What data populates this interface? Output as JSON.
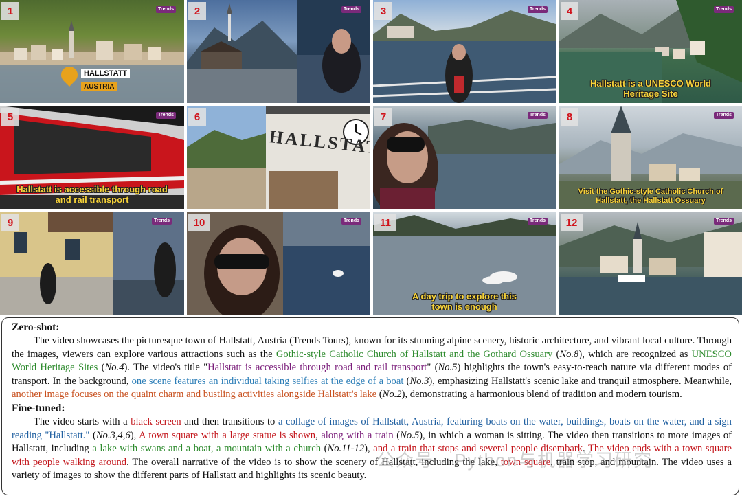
{
  "tiles": [
    {
      "num": "1",
      "wm": "Trends",
      "labels": [
        "HALLSTATT",
        "AUSTRIA"
      ]
    },
    {
      "num": "2",
      "wm": "Trends"
    },
    {
      "num": "3",
      "wm": "Trends"
    },
    {
      "num": "4",
      "wm": "Trends",
      "caption": "Hallstatt is a UNESCO World Heritage Site"
    },
    {
      "num": "5",
      "wm": "Trends",
      "caption": "Hallstatt is accessible through road and rail transport"
    },
    {
      "num": "6",
      "wm": "Trends",
      "sign": "HALLSTATT"
    },
    {
      "num": "7",
      "wm": "Trends"
    },
    {
      "num": "8",
      "wm": "Trends",
      "caption": "Visit the Gothic-style Catholic Church of Hallstatt, the Hallstatt Ossuary"
    },
    {
      "num": "9",
      "wm": "Trends"
    },
    {
      "num": "10",
      "wm": "Trends"
    },
    {
      "num": "11",
      "wm": "Trends",
      "caption": "A day trip to explore this town is enough"
    },
    {
      "num": "12",
      "wm": "Trends"
    }
  ],
  "zero_shot": {
    "heading": "Zero-shot:",
    "t1": "The video showcases the picturesque town of Hallstatt, Austria (Trends Tours), known for its stunning alpine scenery, historic architecture, and vibrant local culture. Through the images, viewers can explore various attractions such as the ",
    "h1": "Gothic-style Catholic Church of Hallstatt and the Gothard Ossuary",
    "t2": " (",
    "n1": "No.8",
    "t3": "), which are recognized as ",
    "h2": "UNESCO World Heritage Sites",
    "t4": " (",
    "n2": "No.4",
    "t5": "). The video's title \"",
    "h3": "Hallstatt is accessible through road and rail transport",
    "t6": "\" (",
    "n3": "No.5",
    "t7": ") highlights the town's easy-to-reach nature via different modes of transport. In the background, ",
    "h4": "one scene features an individual taking selfies at the edge of a boat",
    "t8": " (",
    "n4": "No.3",
    "t9": "), emphasizing Hallstatt's scenic lake and tranquil atmosphere. Meanwhile, ",
    "h5": "another image focuses on the quaint charm and bustling activities alongside Hallstatt's lake",
    "t10": " (",
    "n5": "No.2",
    "t11": "), demonstrating a harmonious blend of tradition and modern tourism."
  },
  "fine_tuned": {
    "heading": "Fine-tuned:",
    "t1": "The video starts with a ",
    "h1": "black screen",
    "t2": " and then transitions to ",
    "h2": "a collage of images of Hallstatt, Austria, featuring boats on the water, buildings, boats on the water, and a sign reading \"Hallstatt.\"",
    "t3": " (",
    "n1": "No.3,4,6",
    "t4": "), ",
    "h3": "A town square with a large statue is shown",
    "t5": ", ",
    "h4": "along with a train",
    "t6": " (",
    "n2": "No.5",
    "t7": "), in which a woman is sitting. The video then transitions to more images of Hallstatt, including ",
    "h5": "a lake with swans and a boat, a mountain with a church",
    "t8": " (",
    "n3": "No.11-12",
    "t9": "), ",
    "h6": "and a train that stops and several people disembark",
    "t10": ". ",
    "h7": "The video ends with a town square with people walking around",
    "t11": ". The overall narrative of the video is to show the scenery of Hallstatt, including the lake, ",
    "h8": "town square",
    "t12": ", train stop, and mountain. The video uses a variety of images to show the different parts of Hallstatt and highlights its scenic beauty."
  },
  "watermark": "公众号 · Python与机器学习研究"
}
